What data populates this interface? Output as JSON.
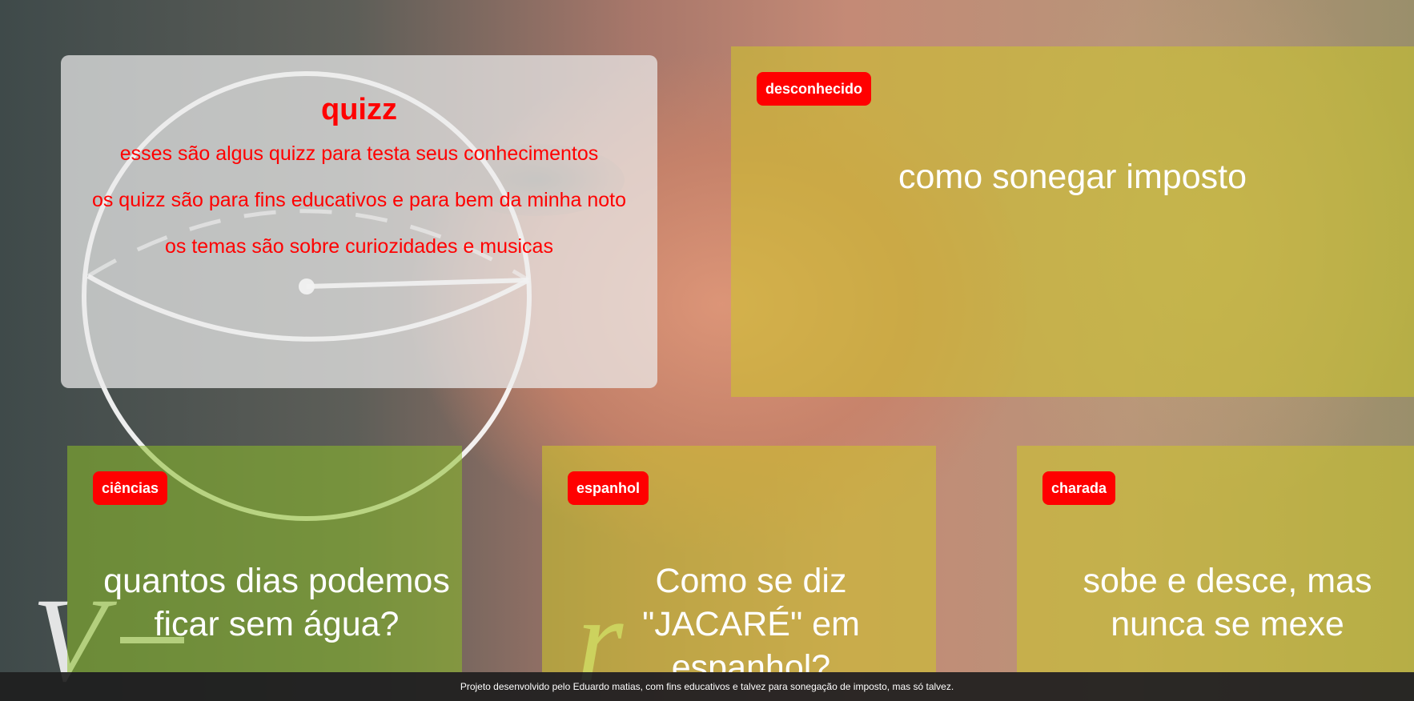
{
  "intro": {
    "title": "quizz",
    "lines": [
      "esses são algus quizz para testa seus conhecimentos",
      "os quizz são para fins educativos e para bem da minha noto",
      "os temas são sobre curiozidades e musicas"
    ]
  },
  "cards": [
    {
      "category": "desconhecido",
      "question": "como sonegar imposto"
    },
    {
      "category": "ciências",
      "question": "quantos dias podemos ficar sem água?"
    },
    {
      "category": "espanhol",
      "question": "Como se diz \"JACARÉ\" em espanhol?"
    },
    {
      "category": "charada",
      "question": "sobe e desce, mas nunca se mexe"
    }
  ],
  "colors": {
    "accent": "#ff0000",
    "card_yellow": "#cdc828",
    "card_green": "#8cbe28"
  },
  "footer": {
    "text": "Projeto desenvolvido pelo Eduardo matias, com fins educativos e talvez para sonegação de imposto, mas só talvez."
  }
}
